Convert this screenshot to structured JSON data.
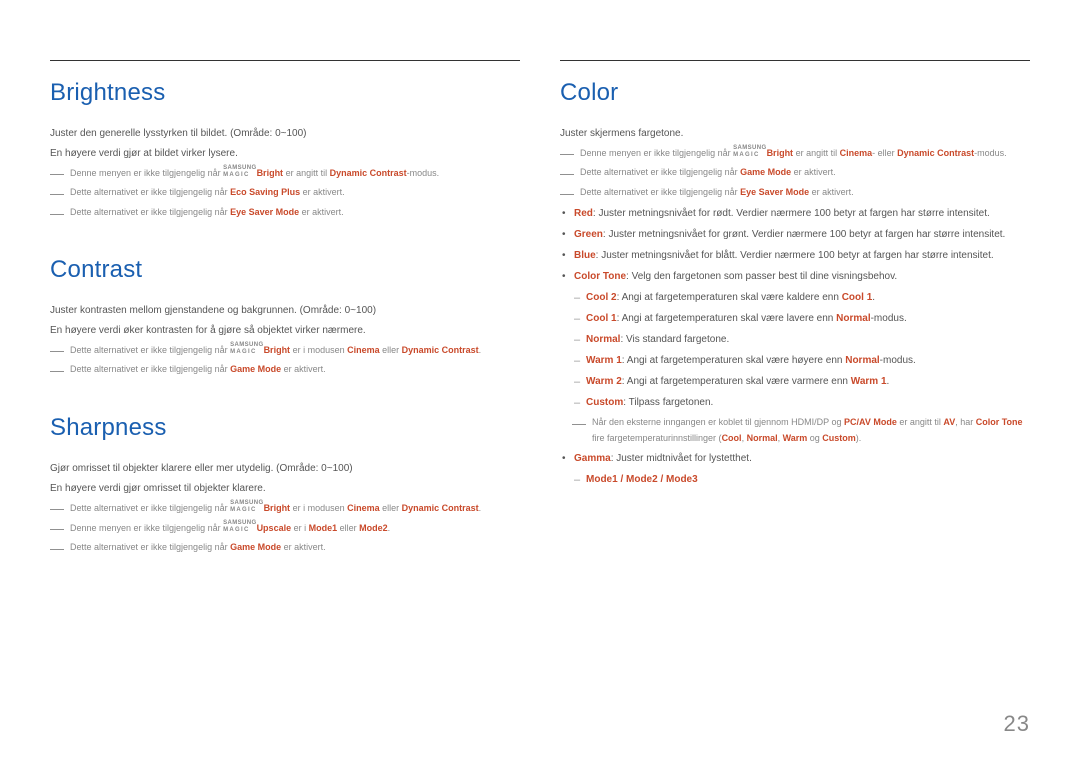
{
  "page_number": "23",
  "left": {
    "brightness": {
      "heading": "Brightness",
      "p1": "Juster den generelle lysstyrken til bildet. (Område: 0~100)",
      "p2": "En høyere verdi gjør at bildet virker lysere.",
      "n1a": "Denne menyen er ikke tilgjengelig når ",
      "n1_bright": "Bright",
      "n1b": " er angitt til ",
      "n1_dc": "Dynamic Contrast",
      "n1c": "-modus.",
      "n2a": "Dette alternativet er ikke tilgjengelig når ",
      "n2_eco": "Eco Saving Plus",
      "n2b": " er aktivert.",
      "n3a": "Dette alternativet er ikke tilgjengelig når ",
      "n3_eye": "Eye Saver Mode",
      "n3b": " er aktivert."
    },
    "contrast": {
      "heading": "Contrast",
      "p1": "Juster kontrasten mellom gjenstandene og bakgrunnen. (Område: 0~100)",
      "p2": "En høyere verdi øker kontrasten for å gjøre så objektet virker nærmere.",
      "n1a": "Dette alternativet er ikke tilgjengelig når ",
      "n1_bright": "Bright",
      "n1b": " er i modusen ",
      "n1_cin": "Cinema",
      "n1c": " eller ",
      "n1_dc": "Dynamic Contrast",
      "n1d": ".",
      "n2a": "Dette alternativet er ikke tilgjengelig når ",
      "n2_gm": "Game Mode",
      "n2b": " er aktivert."
    },
    "sharpness": {
      "heading": "Sharpness",
      "p1": "Gjør omrisset til objekter klarere eller mer utydelig. (Område: 0~100)",
      "p2": "En høyere verdi gjør omrisset til objekter klarere.",
      "n1a": "Dette alternativet er ikke tilgjengelig når ",
      "n1_bright": "Bright",
      "n1b": " er i modusen ",
      "n1_cin": "Cinema",
      "n1c": " eller ",
      "n1_dc": "Dynamic Contrast",
      "n1d": ".",
      "n2a": "Denne menyen er ikke tilgjengelig når ",
      "n2_up": "Upscale",
      "n2b": " er i ",
      "n2_m1": "Mode1",
      "n2c": " eller ",
      "n2_m2": "Mode2",
      "n2d": ".",
      "n3a": "Dette alternativet er ikke tilgjengelig når ",
      "n3_gm": "Game Mode",
      "n3b": " er aktivert."
    }
  },
  "right": {
    "color": {
      "heading": "Color",
      "p1": "Juster skjermens fargetone.",
      "n1a": "Denne menyen er ikke tilgjengelig når ",
      "n1_bright": "Bright",
      "n1b": " er angitt til ",
      "n1_cin": "Cinema",
      "n1c": "- eller ",
      "n1_dc": "Dynamic Contrast",
      "n1d": "-modus.",
      "n2a": "Dette alternativet er ikke tilgjengelig når ",
      "n2_gm": "Game Mode",
      "n2b": " er aktivert.",
      "n3a": "Dette alternativet er ikke tilgjengelig når ",
      "n3_eye": "Eye Saver Mode",
      "n3b": " er aktivert.",
      "red_label": "Red",
      "red_text": ": Juster metningsnivået for rødt. Verdier nærmere 100 betyr at fargen har større intensitet.",
      "green_label": "Green",
      "green_text": ": Juster metningsnivået for grønt. Verdier nærmere 100 betyr at fargen har større intensitet.",
      "blue_label": "Blue",
      "blue_text": ": Juster metningsnivået for blått. Verdier nærmere 100 betyr at fargen har større intensitet.",
      "ct_label": "Color Tone",
      "ct_text": ": Velg den fargetonen som passer best til dine visningsbehov.",
      "cool2_label": "Cool 2",
      "cool2_text_a": ": Angi at fargetemperaturen skal være kaldere enn ",
      "cool2_ref": "Cool 1",
      "cool2_text_b": ".",
      "cool1_label": "Cool 1",
      "cool1_text_a": ": Angi at fargetemperaturen skal være lavere enn ",
      "cool1_ref": "Normal",
      "cool1_text_b": "-modus.",
      "normal_label": "Normal",
      "normal_text": ": Vis standard fargetone.",
      "warm1_label": "Warm 1",
      "warm1_text_a": ": Angi at fargetemperaturen skal være høyere enn ",
      "warm1_ref": "Normal",
      "warm1_text_b": "-modus.",
      "warm2_label": "Warm 2",
      "warm2_text_a": ": Angi at fargetemperaturen skal være varmere enn ",
      "warm2_ref": "Warm 1",
      "warm2_text_b": ".",
      "custom_label": "Custom",
      "custom_text": ": Tilpass fargetonen.",
      "extnote_a": "Når den eksterne inngangen er koblet til gjennom HDMI/DP og ",
      "extnote_pc": "PC/AV Mode",
      "extnote_b": " er angitt til ",
      "extnote_av": "AV",
      "extnote_c": ", har ",
      "extnote_ct": "Color Tone",
      "extnote_d": " fire fargetemperaturinnstillinger (",
      "extnote_cool": "Cool",
      "extnote_norm": "Normal",
      "extnote_warm": "Warm",
      "extnote_and": " og ",
      "extnote_cust": "Custom",
      "extnote_e": ").",
      "extnote_sep": ", ",
      "gamma_label": "Gamma",
      "gamma_text": ": Juster midtnivået for lystetthet.",
      "modes": "Mode1 / Mode2 / Mode3"
    }
  }
}
